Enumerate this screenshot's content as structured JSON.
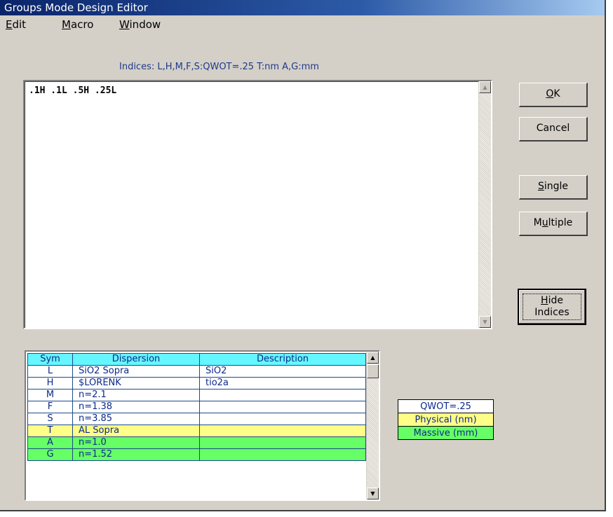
{
  "window": {
    "title": "Groups Mode Design Editor"
  },
  "menu": [
    {
      "mnemonic": "E",
      "rest": "dit"
    },
    {
      "mnemonic": "M",
      "rest": "acro"
    },
    {
      "mnemonic": "W",
      "rest": "indow"
    }
  ],
  "indices_label": "Indices: L,H,M,F,S:QWOT=.25  T:nm  A,G:mm",
  "editor": {
    "text": ".1H .1L .5H .25L"
  },
  "buttons": {
    "ok": {
      "mnemonic": "O",
      "rest": "K"
    },
    "cancel": "Cancel",
    "single": {
      "mnemonic": "S",
      "rest": "ingle"
    },
    "multiple": {
      "pre": "M",
      "mnemonic": "u",
      "rest": "ltiple"
    },
    "hide": {
      "mnemonic": "H",
      "rest": "ide",
      "line2": "Indices"
    }
  },
  "table": {
    "headers": {
      "sym": "Sym",
      "dispersion": "Dispersion",
      "description": "Description"
    },
    "rows": [
      {
        "sym": "L",
        "dispersion": "SiO2 Sopra",
        "description": "SiO2",
        "color": "white"
      },
      {
        "sym": "H",
        "dispersion": "$LORENK",
        "description": "tio2a",
        "color": "white"
      },
      {
        "sym": "M",
        "dispersion": "n=2.1",
        "description": "",
        "color": "white"
      },
      {
        "sym": "F",
        "dispersion": "n=1.38",
        "description": "",
        "color": "white"
      },
      {
        "sym": "S",
        "dispersion": "n=3.85",
        "description": "",
        "color": "white"
      },
      {
        "sym": "T",
        "dispersion": "AL Sopra",
        "description": "",
        "color": "yellow"
      },
      {
        "sym": "A",
        "dispersion": "n=1.0",
        "description": "",
        "color": "green"
      },
      {
        "sym": "G",
        "dispersion": "n=1.52",
        "description": "",
        "color": "green"
      }
    ]
  },
  "legend": {
    "qwot": "QWOT=.25",
    "physical": "Physical (nm)",
    "massive": "Massive (mm)"
  },
  "colors": {
    "header_cyan": "#66f6ff",
    "yellow": "#ffff88",
    "green": "#66ff66",
    "text_blue": "#0c2a8a",
    "title_blue": "#0a246a"
  },
  "icons": {
    "scroll_up": "▲",
    "scroll_down": "▼"
  }
}
